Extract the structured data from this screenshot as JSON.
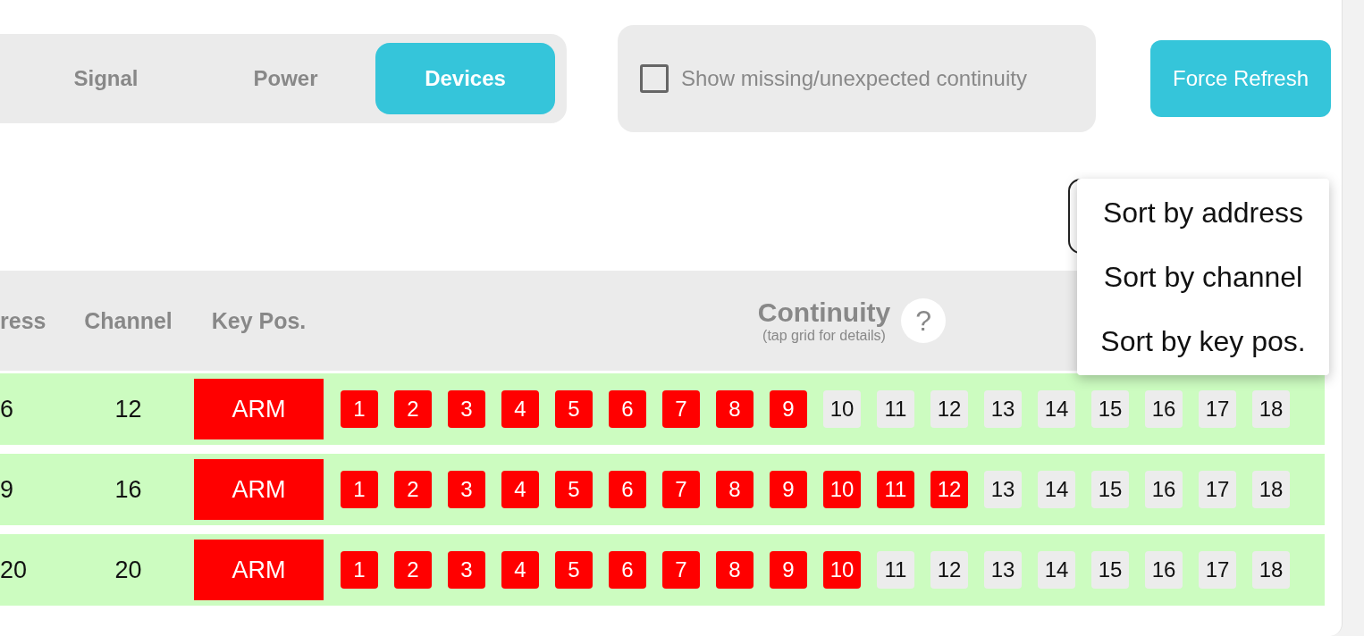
{
  "tabs": [
    {
      "label": "Signal",
      "selected": false
    },
    {
      "label": "Power",
      "selected": false
    },
    {
      "label": "Devices",
      "selected": true
    }
  ],
  "show_missing": {
    "label": "Show missing/unexpected continuity",
    "checked": false
  },
  "refresh_button": "Force Refresh",
  "sort_menu": {
    "items": [
      "Sort by address",
      "Sort by channel",
      "Sort by key pos."
    ]
  },
  "table": {
    "columns": [
      "ress",
      "Channel",
      "Key Pos."
    ],
    "continuity_title": "Continuity",
    "continuity_hint": "(tap grid for details)",
    "help": "?",
    "rows": [
      {
        "address": "6",
        "channel": "12",
        "key_pos": "ARM",
        "continuity": [
          {
            "label": "1",
            "on": true
          },
          {
            "label": "2",
            "on": true
          },
          {
            "label": "3",
            "on": true
          },
          {
            "label": "4",
            "on": true
          },
          {
            "label": "5",
            "on": true
          },
          {
            "label": "6",
            "on": true
          },
          {
            "label": "7",
            "on": true
          },
          {
            "label": "8",
            "on": true
          },
          {
            "label": "9",
            "on": true
          },
          {
            "label": "10",
            "on": false
          },
          {
            "label": "11",
            "on": false
          },
          {
            "label": "12",
            "on": false
          },
          {
            "label": "13",
            "on": false
          },
          {
            "label": "14",
            "on": false
          },
          {
            "label": "15",
            "on": false
          },
          {
            "label": "16",
            "on": false
          },
          {
            "label": "17",
            "on": false
          },
          {
            "label": "18",
            "on": false
          }
        ]
      },
      {
        "address": "9",
        "channel": "16",
        "key_pos": "ARM",
        "continuity": [
          {
            "label": "1",
            "on": true
          },
          {
            "label": "2",
            "on": true
          },
          {
            "label": "3",
            "on": true
          },
          {
            "label": "4",
            "on": true
          },
          {
            "label": "5",
            "on": true
          },
          {
            "label": "6",
            "on": true
          },
          {
            "label": "7",
            "on": true
          },
          {
            "label": "8",
            "on": true
          },
          {
            "label": "9",
            "on": true
          },
          {
            "label": "10",
            "on": true
          },
          {
            "label": "11",
            "on": true
          },
          {
            "label": "12",
            "on": true
          },
          {
            "label": "13",
            "on": false
          },
          {
            "label": "14",
            "on": false
          },
          {
            "label": "15",
            "on": false
          },
          {
            "label": "16",
            "on": false
          },
          {
            "label": "17",
            "on": false
          },
          {
            "label": "18",
            "on": false
          }
        ]
      },
      {
        "address": "20",
        "channel": "20",
        "key_pos": "ARM",
        "continuity": [
          {
            "label": "1",
            "on": true
          },
          {
            "label": "2",
            "on": true
          },
          {
            "label": "3",
            "on": true
          },
          {
            "label": "4",
            "on": true
          },
          {
            "label": "5",
            "on": true
          },
          {
            "label": "6",
            "on": true
          },
          {
            "label": "7",
            "on": true
          },
          {
            "label": "8",
            "on": true
          },
          {
            "label": "9",
            "on": true
          },
          {
            "label": "10",
            "on": true
          },
          {
            "label": "11",
            "on": false
          },
          {
            "label": "12",
            "on": false
          },
          {
            "label": "13",
            "on": false
          },
          {
            "label": "14",
            "on": false
          },
          {
            "label": "15",
            "on": false
          },
          {
            "label": "16",
            "on": false
          },
          {
            "label": "17",
            "on": false
          },
          {
            "label": "18",
            "on": false
          }
        ]
      }
    ]
  }
}
